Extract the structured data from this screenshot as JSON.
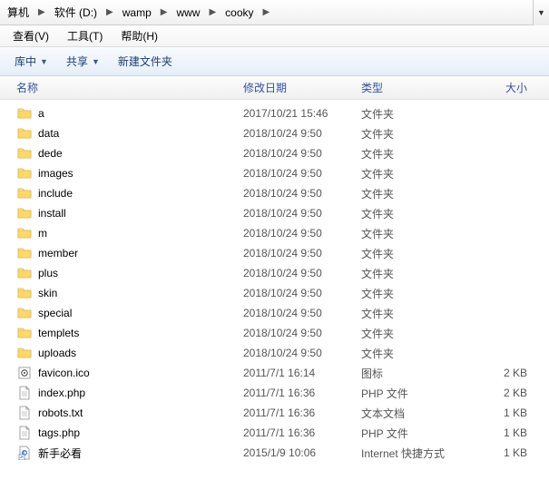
{
  "breadcrumb": {
    "items": [
      "算机",
      "软件 (D:)",
      "wamp",
      "www",
      "cooky"
    ]
  },
  "menubar": {
    "items": [
      "查看(V)",
      "工具(T)",
      "帮助(H)"
    ]
  },
  "toolbar": {
    "library_label": "库中",
    "share_label": "共享",
    "newfolder_label": "新建文件夹"
  },
  "columns": {
    "name": "名称",
    "date": "修改日期",
    "type": "类型",
    "size": "大小"
  },
  "files": [
    {
      "icon": "folder",
      "name": "a",
      "date": "2017/10/21 15:46",
      "type": "文件夹",
      "size": ""
    },
    {
      "icon": "folder",
      "name": "data",
      "date": "2018/10/24 9:50",
      "type": "文件夹",
      "size": ""
    },
    {
      "icon": "folder",
      "name": "dede",
      "date": "2018/10/24 9:50",
      "type": "文件夹",
      "size": ""
    },
    {
      "icon": "folder",
      "name": "images",
      "date": "2018/10/24 9:50",
      "type": "文件夹",
      "size": ""
    },
    {
      "icon": "folder",
      "name": "include",
      "date": "2018/10/24 9:50",
      "type": "文件夹",
      "size": ""
    },
    {
      "icon": "folder",
      "name": "install",
      "date": "2018/10/24 9:50",
      "type": "文件夹",
      "size": ""
    },
    {
      "icon": "folder",
      "name": "m",
      "date": "2018/10/24 9:50",
      "type": "文件夹",
      "size": ""
    },
    {
      "icon": "folder",
      "name": "member",
      "date": "2018/10/24 9:50",
      "type": "文件夹",
      "size": ""
    },
    {
      "icon": "folder",
      "name": "plus",
      "date": "2018/10/24 9:50",
      "type": "文件夹",
      "size": ""
    },
    {
      "icon": "folder",
      "name": "skin",
      "date": "2018/10/24 9:50",
      "type": "文件夹",
      "size": ""
    },
    {
      "icon": "folder",
      "name": "special",
      "date": "2018/10/24 9:50",
      "type": "文件夹",
      "size": ""
    },
    {
      "icon": "folder",
      "name": "templets",
      "date": "2018/10/24 9:50",
      "type": "文件夹",
      "size": ""
    },
    {
      "icon": "folder",
      "name": "uploads",
      "date": "2018/10/24 9:50",
      "type": "文件夹",
      "size": ""
    },
    {
      "icon": "ico",
      "name": "favicon.ico",
      "date": "2011/7/1 16:14",
      "type": "图标",
      "size": "2 KB"
    },
    {
      "icon": "file",
      "name": "index.php",
      "date": "2011/7/1 16:36",
      "type": "PHP 文件",
      "size": "2 KB"
    },
    {
      "icon": "file",
      "name": "robots.txt",
      "date": "2011/7/1 16:36",
      "type": "文本文档",
      "size": "1 KB"
    },
    {
      "icon": "file",
      "name": "tags.php",
      "date": "2011/7/1 16:36",
      "type": "PHP 文件",
      "size": "1 KB"
    },
    {
      "icon": "shortcut",
      "name": "新手必看",
      "date": "2015/1/9 10:06",
      "type": "Internet 快捷方式",
      "size": "1 KB"
    }
  ]
}
